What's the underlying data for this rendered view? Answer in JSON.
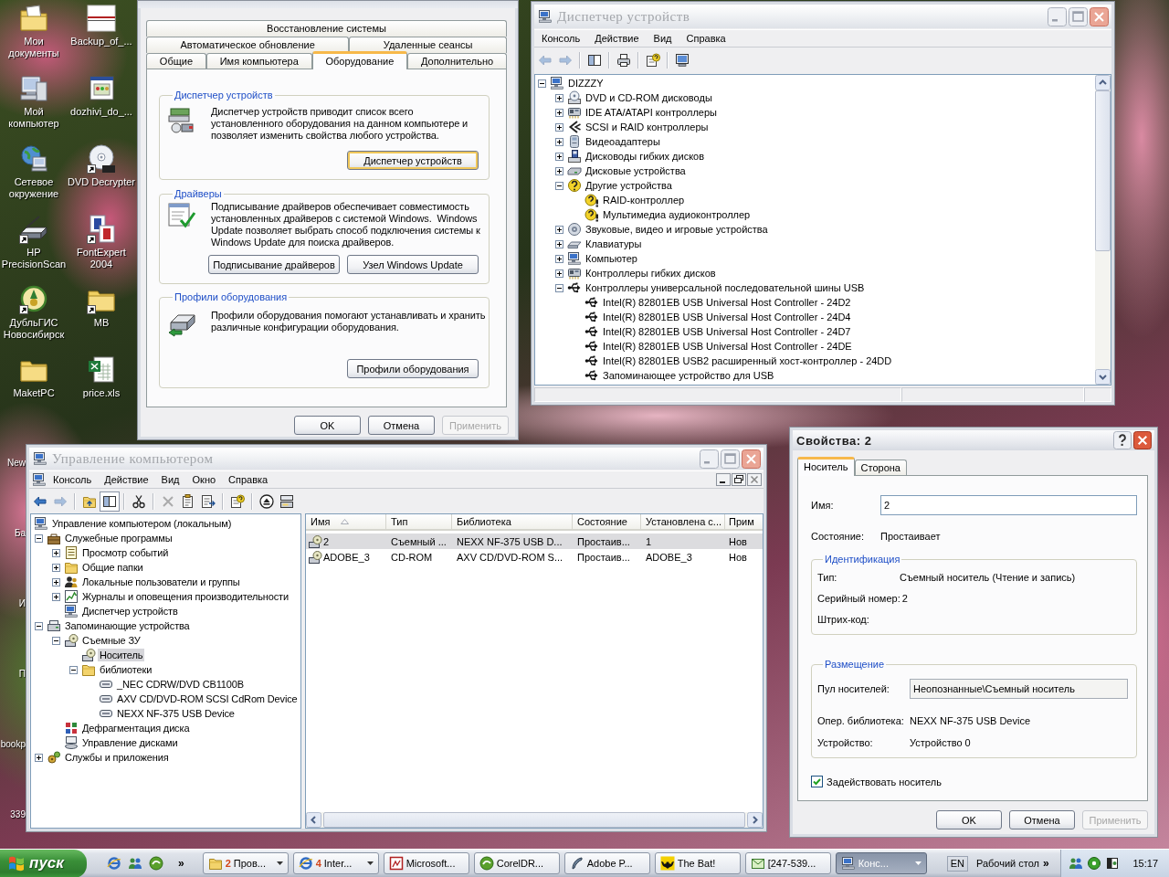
{
  "desktop": {
    "icons": [
      {
        "label": "Мои документы",
        "kind": "documents",
        "shortcut": false
      },
      {
        "label": "Backup_of_...",
        "kind": "document",
        "shortcut": false
      },
      {
        "label": "Мой компьютер",
        "kind": "computer",
        "shortcut": false
      },
      {
        "label": "dozhivi_do_...",
        "kind": "webpage",
        "shortcut": false
      },
      {
        "label": "Сетевое окружение",
        "kind": "network",
        "shortcut": false
      },
      {
        "label": "DVD Decrypter",
        "kind": "disc",
        "shortcut": true
      },
      {
        "label": "HP PrecisionScan",
        "kind": "scanner",
        "shortcut": true
      },
      {
        "label": "FontExpert 2004",
        "kind": "font",
        "shortcut": true
      },
      {
        "label": "ДубльГИС Новосибирск",
        "kind": "emblem",
        "shortcut": true
      },
      {
        "label": "MB",
        "kind": "folder",
        "shortcut": true
      },
      {
        "label": "MaketPC",
        "kind": "folder",
        "shortcut": false
      },
      {
        "label": "price.xls",
        "kind": "spreadsheet",
        "shortcut": false
      }
    ],
    "covered_labels": [
      "New",
      "Ба",
      "И",
      "П",
      "bookp",
      "339"
    ]
  },
  "system_properties": {
    "tab_rows": [
      {
        "tabs": [
          {
            "label": "Восстановление системы",
            "selected": false
          }
        ]
      },
      {
        "tabs": [
          {
            "label": "Автоматическое обновление",
            "selected": false
          },
          {
            "label": "Удаленные сеансы",
            "selected": false
          }
        ]
      },
      {
        "tabs": [
          {
            "label": "Общие",
            "selected": false
          },
          {
            "label": "Имя компьютера",
            "selected": false
          },
          {
            "label": "Оборудование",
            "selected": true
          },
          {
            "label": "Дополнительно",
            "selected": false
          }
        ]
      }
    ],
    "groups": [
      {
        "title": "Диспетчер устройств",
        "kind": "devices",
        "text": "Диспетчер устройств приводит список всего установленного оборудования на данном компьютере и позволяет изменить свойства любого устройства.",
        "buttons": [
          {
            "label": "Диспетчер устройств",
            "focused": true
          }
        ]
      },
      {
        "title": "Драйверы",
        "kind": "drivers",
        "text": "Подписывание драйверов обеспечивает совместимость установленных драйверов с системой Windows.  Windows Update позволяет выбрать способ подключения системы к Windows Update для поиска драйверов.",
        "buttons": [
          {
            "label": "Подписывание драйверов",
            "focused": false
          },
          {
            "label": "Узел Windows Update",
            "focused": false
          }
        ]
      },
      {
        "title": "Профили оборудования",
        "kind": "profiles",
        "text": "Профили оборудования помогают устанавливать и хранить различные конфигурации оборудования.",
        "buttons": [
          {
            "label": "Профили оборудования",
            "focused": false
          }
        ]
      }
    ],
    "buttons": [
      {
        "label": "OK",
        "disabled": false
      },
      {
        "label": "Отмена",
        "disabled": false
      },
      {
        "label": "Применить",
        "disabled": true
      }
    ]
  },
  "device_manager": {
    "title": "Диспетчер устройств",
    "menu": [
      "Консоль",
      "Действие",
      "Вид",
      "Справка"
    ],
    "toolbar": [
      {
        "kind": "back",
        "disabled": true
      },
      {
        "kind": "forward",
        "disabled": true
      },
      {
        "kind": "separator"
      },
      {
        "kind": "tree",
        "disabled": false
      },
      {
        "kind": "separator"
      },
      {
        "kind": "print",
        "disabled": false
      },
      {
        "kind": "separator"
      },
      {
        "kind": "help",
        "disabled": false
      },
      {
        "kind": "separator"
      },
      {
        "kind": "scan",
        "disabled": false
      }
    ],
    "tree": {
      "label": "DIZZZY",
      "kind": "computer",
      "expanded": true,
      "children": [
        {
          "label": "DVD и CD-ROM дисководы",
          "kind": "cd-drive",
          "expanded": false
        },
        {
          "label": "IDE ATA/ATAPI контроллеры",
          "kind": "controller",
          "expanded": false
        },
        {
          "label": "SCSI и RAID контроллеры",
          "kind": "scsi",
          "expanded": false
        },
        {
          "label": "Видеоадаптеры",
          "kind": "display",
          "expanded": false
        },
        {
          "label": "Дисководы гибких дисков",
          "kind": "floppy",
          "expanded": false
        },
        {
          "label": "Дисковые устройства",
          "kind": "disk",
          "expanded": false
        },
        {
          "label": "Другие устройства",
          "kind": "unknown",
          "expanded": true,
          "children": [
            {
              "label": "RAID-контроллер",
              "kind": "warning"
            },
            {
              "label": "Мультимедиа аудиоконтроллер",
              "kind": "warning"
            }
          ]
        },
        {
          "label": "Звуковые, видео и игровые устройства",
          "kind": "sound",
          "expanded": false
        },
        {
          "label": "Клавиатуры",
          "kind": "keyboard",
          "expanded": false
        },
        {
          "label": "Компьютер",
          "kind": "computer",
          "expanded": false
        },
        {
          "label": "Контроллеры гибких дисков",
          "kind": "controller",
          "expanded": false
        },
        {
          "label": "Контроллеры универсальной последовательной шины USB",
          "kind": "usb",
          "expanded": true,
          "children": [
            {
              "label": "Intel(R) 82801EB USB Universal Host Controller - 24D2",
              "kind": "usb"
            },
            {
              "label": "Intel(R) 82801EB USB Universal Host Controller - 24D4",
              "kind": "usb"
            },
            {
              "label": "Intel(R) 82801EB USB Universal Host Controller - 24D7",
              "kind": "usb"
            },
            {
              "label": "Intel(R) 82801EB USB Universal Host Controller - 24DE",
              "kind": "usb"
            },
            {
              "label": "Intel(R) 82801EB USB2 расширенный хост-контроллер - 24DD",
              "kind": "usb"
            },
            {
              "label": "Запоминающее устройство для USB",
              "kind": "usb"
            }
          ]
        }
      ]
    }
  },
  "computer_management": {
    "title": "Управление компьютером",
    "menu": [
      "Консоль",
      "Действие",
      "Вид",
      "Окно",
      "Справка"
    ],
    "toolbar": [
      {
        "kind": "back",
        "disabled": false,
        "pressed": false
      },
      {
        "kind": "forward",
        "disabled": true,
        "pressed": false
      },
      {
        "kind": "separator"
      },
      {
        "kind": "up",
        "disabled": false,
        "pressed": false
      },
      {
        "kind": "tree",
        "disabled": false,
        "pressed": true
      },
      {
        "kind": "separator"
      },
      {
        "kind": "cut",
        "disabled": false,
        "pressed": false
      },
      {
        "kind": "separator"
      },
      {
        "kind": "delete",
        "disabled": true,
        "pressed": false
      },
      {
        "kind": "properties",
        "disabled": false,
        "pressed": false
      },
      {
        "kind": "export",
        "disabled": false,
        "pressed": false
      },
      {
        "kind": "separator"
      },
      {
        "kind": "help",
        "disabled": false,
        "pressed": false
      },
      {
        "kind": "separator"
      },
      {
        "kind": "eject",
        "disabled": false,
        "pressed": false
      },
      {
        "kind": "library",
        "disabled": false,
        "pressed": false
      }
    ],
    "tree": {
      "label": "Управление компьютером (локальным)",
      "kind": "computer",
      "selected": false,
      "children": [
        {
          "label": "Служебные программы",
          "kind": "tools",
          "expanded": true,
          "selected": false,
          "children": [
            {
              "label": "Просмотр событий",
              "kind": "events",
              "expanded": false,
              "selected": false
            },
            {
              "label": "Общие папки",
              "kind": "folder",
              "expanded": false,
              "selected": false
            },
            {
              "label": "Локальные пользователи и группы",
              "kind": "users",
              "expanded": false,
              "selected": false
            },
            {
              "label": "Журналы и оповещения производительности",
              "kind": "performance",
              "expanded": false,
              "selected": false
            },
            {
              "label": "Диспетчер устройств",
              "kind": "computer",
              "selected": false
            }
          ]
        },
        {
          "label": "Запоминающие устройства",
          "kind": "storage",
          "expanded": true,
          "selected": false,
          "children": [
            {
              "label": "Съемные ЗУ",
              "kind": "removable",
              "expanded": true,
              "selected": false,
              "children": [
                {
                  "label": "Носитель",
                  "kind": "media",
                  "selected": true
                },
                {
                  "label": "библиотеки",
                  "kind": "folder",
                  "expanded": true,
                  "selected": false,
                  "children": [
                    {
                      "label": "_NEC CDRW/DVD CB1100B",
                      "kind": "library-drive",
                      "selected": false
                    },
                    {
                      "label": "AXV CD/DVD-ROM SCSI CdRom Device",
                      "kind": "library-drive",
                      "selected": false
                    },
                    {
                      "label": "NEXX NF-375 USB Device",
                      "kind": "library-drive",
                      "selected": false
                    }
                  ]
                }
              ]
            },
            {
              "label": "Дефрагментация диска",
              "kind": "defrag",
              "selected": false
            },
            {
              "label": "Управление дисками",
              "kind": "disk-management",
              "selected": false
            }
          ]
        },
        {
          "label": "Службы и приложения",
          "kind": "services",
          "expanded": false,
          "selected": false
        }
      ]
    },
    "list": {
      "columns": [
        {
          "label": "Имя",
          "sorted": true
        },
        {
          "label": "Тип",
          "sorted": false
        },
        {
          "label": "Библиотека",
          "sorted": false
        },
        {
          "label": "Состояние",
          "sorted": false
        },
        {
          "label": "Установлена с...",
          "sorted": false
        },
        {
          "label": "Прим",
          "sorted": false
        }
      ],
      "rows": [
        {
          "kind": "media",
          "selected": true,
          "cells": [
            "2",
            "Съемный ...",
            "NEXX NF-375 USB D...",
            "Простаив...",
            "1",
            "Нов"
          ]
        },
        {
          "kind": "media",
          "selected": false,
          "cells": [
            "ADOBE_3",
            "CD-ROM",
            "AXV CD/DVD-ROM S...",
            "Простаив...",
            "ADOBE_3",
            "Нов"
          ]
        }
      ]
    }
  },
  "media_properties": {
    "title": "Свойства: 2",
    "tabs": [
      {
        "label": "Носитель",
        "selected": true
      },
      {
        "label": "Сторона",
        "selected": false
      }
    ],
    "name": {
      "label": "Имя:",
      "value": "2"
    },
    "state": {
      "label": "Состояние:",
      "value": "Простаивает"
    },
    "identification": {
      "title": "Идентификация",
      "rows": [
        {
          "label": "Тип:",
          "value": "Съемный носитель (Чтение и запись)"
        },
        {
          "label": "Серийный номер:",
          "value": "2"
        },
        {
          "label": "Штрих-код:"
        }
      ]
    },
    "placement": {
      "title": "Размещение",
      "rows": [
        {
          "kind": "field",
          "label": "Пул носителей:",
          "value": "Неопознанные\\Съемный носитель"
        },
        {
          "kind": "text",
          "label": "Опер. библиотека:",
          "value": "NEXX NF-375 USB Device"
        },
        {
          "kind": "text",
          "label": "Устройство:",
          "value": "Устройство 0"
        }
      ]
    },
    "enable": {
      "label": "Задействовать носитель",
      "checked": true
    },
    "buttons": [
      {
        "label": "OK",
        "disabled": false
      },
      {
        "label": "Отмена",
        "disabled": false
      },
      {
        "label": "Применить",
        "disabled": true
      }
    ]
  },
  "taskbar": {
    "start": "пуск",
    "quick_launch": [
      {
        "kind": "browser"
      },
      {
        "kind": "people"
      },
      {
        "kind": "swirl"
      }
    ],
    "quick_more": "»",
    "tasks": [
      {
        "label": "Пров...",
        "count": "2",
        "kind": "folder",
        "grouped": true,
        "selected": false
      },
      {
        "label": "Inter...",
        "count": "4",
        "kind": "browser",
        "grouped": true,
        "selected": false
      },
      {
        "label": "Microsoft...",
        "kind": "office",
        "grouped": false,
        "selected": false
      },
      {
        "label": "CorelDR...",
        "kind": "swirl",
        "grouped": false,
        "selected": false
      },
      {
        "label": "Adobe P...",
        "kind": "feather",
        "grouped": false,
        "selected": false
      },
      {
        "label": "The Bat!",
        "kind": "bat",
        "grouped": false,
        "selected": false
      },
      {
        "label": "[247-539...",
        "kind": "mail",
        "grouped": false,
        "selected": false
      },
      {
        "label": "Конс...",
        "kind": "computer",
        "grouped": true,
        "selected": true
      }
    ],
    "language": "EN",
    "desktop_toolbar": "Рабочий стол",
    "desktop_more": "»",
    "tray": [
      {
        "kind": "people"
      },
      {
        "kind": "badge"
      },
      {
        "kind": "window"
      }
    ],
    "clock": "15:17"
  }
}
